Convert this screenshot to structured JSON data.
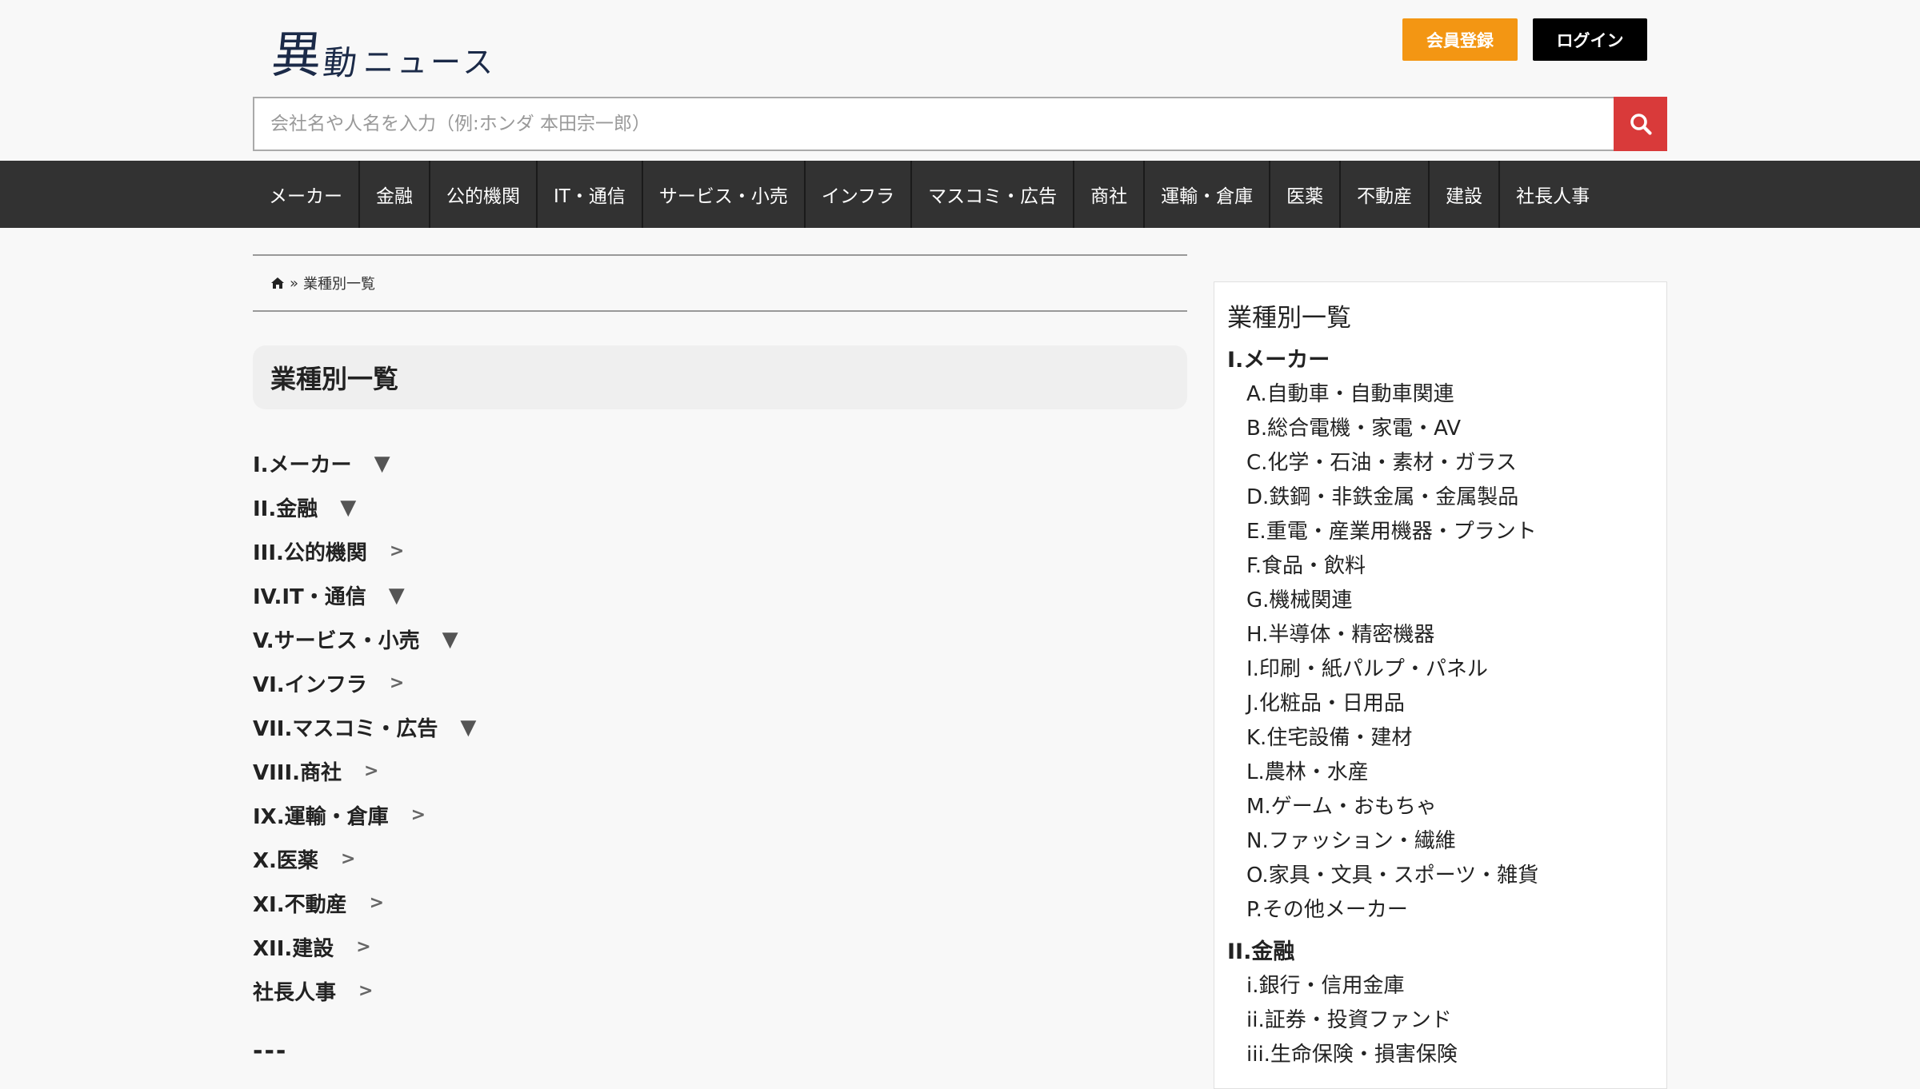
{
  "header": {
    "logo_kanji_1": "異",
    "logo_kanji_2": "動",
    "logo_text": "ニュース",
    "register_label": "会員登録",
    "login_label": "ログイン"
  },
  "search": {
    "placeholder": "会社名や人名を入力（例:ホンダ 本田宗一郎）",
    "value": ""
  },
  "nav": {
    "items": [
      "メーカー",
      "金融",
      "公的機関",
      "IT・通信",
      "サービス・小売",
      "インフラ",
      "マスコミ・広告",
      "商社",
      "運輸・倉庫",
      "医薬",
      "不動産",
      "建設",
      "社長人事"
    ]
  },
  "breadcrumb": {
    "separator": "»",
    "current": "業種別一覧"
  },
  "page_title": "業種別一覧",
  "categories": [
    {
      "label": "I.メーカー",
      "arrow": "▼"
    },
    {
      "label": "II.金融",
      "arrow": "▼"
    },
    {
      "label": "III.公的機関",
      "arrow": ">"
    },
    {
      "label": "IV.IT・通信",
      "arrow": "▼"
    },
    {
      "label": "V.サービス・小売",
      "arrow": "▼"
    },
    {
      "label": "VI.インフラ",
      "arrow": ">"
    },
    {
      "label": "VII.マスコミ・広告",
      "arrow": "▼"
    },
    {
      "label": "VIII.商社",
      "arrow": ">"
    },
    {
      "label": "IX.運輸・倉庫",
      "arrow": ">"
    },
    {
      "label": "X.医薬",
      "arrow": ">"
    },
    {
      "label": "XI.不動産",
      "arrow": ">"
    },
    {
      "label": "XII.建設",
      "arrow": ">"
    },
    {
      "label": "社長人事",
      "arrow": ">"
    }
  ],
  "divider_text": "---",
  "sidebar": {
    "title": "業種別一覧",
    "groups": [
      {
        "label": "I.メーカー",
        "items": [
          "A.自動車・自動車関連",
          "B.総合電機・家電・AV",
          "C.化学・石油・素材・ガラス",
          "D.鉄鋼・非鉄金属・金属製品",
          "E.重電・産業用機器・プラント",
          "F.食品・飲料",
          "G.機械関連",
          "H.半導体・精密機器",
          "I.印刷・紙パルプ・パネル",
          "J.化粧品・日用品",
          "K.住宅設備・建材",
          "L.農林・水産",
          "M.ゲーム・おもちゃ",
          "N.ファッション・繊維",
          "O.家具・文具・スポーツ・雑貨",
          "P.その他メーカー"
        ]
      },
      {
        "label": "II.金融",
        "items": [
          "i.銀行・信用金庫",
          "ii.証券・投資ファンド",
          "iii.生命保険・損害保険"
        ]
      }
    ]
  }
}
